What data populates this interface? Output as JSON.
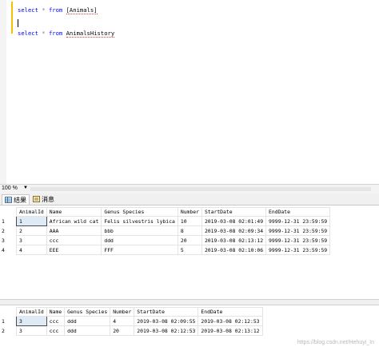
{
  "editor": {
    "line1": {
      "kw1": "select",
      "op": "*",
      "kw2": "from",
      "obj": "[Animals]"
    },
    "line2": {
      "kw1": "select",
      "op": "*",
      "kw2": "from",
      "obj": "AnimalsHistory"
    }
  },
  "zoom": {
    "value": "100 %"
  },
  "tabs": [
    {
      "label": "结果",
      "icon": "grid-icon"
    },
    {
      "label": "消息",
      "icon": "message-icon"
    }
  ],
  "grid1": {
    "columns": [
      "AnimalId",
      "Name",
      "Genus Species",
      "Number",
      "StartDate",
      "EndDate"
    ],
    "rows": [
      {
        "n": "1",
        "cells": [
          "1",
          "African wild cat",
          "Felis silvestris lybica",
          "10",
          "2019-03-08 02:01:49",
          "9999-12-31 23:59:59"
        ]
      },
      {
        "n": "2",
        "cells": [
          "2",
          "AAA",
          "bbb",
          "8",
          "2019-03-08 02:09:34",
          "9999-12-31 23:59:59"
        ]
      },
      {
        "n": "3",
        "cells": [
          "3",
          "ccc",
          "ddd",
          "20",
          "2019-03-08 02:13:12",
          "9999-12-31 23:59:59"
        ]
      },
      {
        "n": "4",
        "cells": [
          "4",
          "EEE",
          "FFF",
          "5",
          "2019-03-08 02:10:06",
          "9999-12-31 23:59:59"
        ]
      }
    ]
  },
  "grid2": {
    "columns": [
      "AnimalId",
      "Name",
      "Genus Species",
      "Number",
      "StartDate",
      "EndDate"
    ],
    "rows": [
      {
        "n": "1",
        "cells": [
          "3",
          "ccc",
          "ddd",
          "4",
          "2019-03-08 02:09:55",
          "2019-03-08 02:12:53"
        ]
      },
      {
        "n": "2",
        "cells": [
          "3",
          "ccc",
          "ddd",
          "20",
          "2019-03-08 02:12:53",
          "2019-03-08 02:13:12"
        ]
      }
    ]
  },
  "watermark": "https://blog.csdn.net/Hehuyi_In",
  "colors": {
    "keyword": "#0000ff",
    "change_bar": "#f2c200",
    "selected_cell": "#dfeaf7"
  }
}
